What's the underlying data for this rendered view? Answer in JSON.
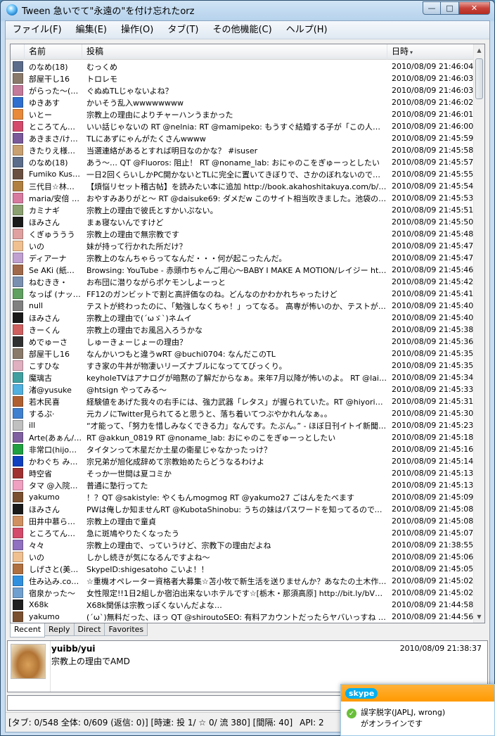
{
  "window": {
    "title": "Tween 急いでて\"永遠の\"を付け忘れたorz",
    "min_glyph": "—",
    "max_glyph": "□",
    "close_glyph": "✕"
  },
  "menu": [
    "ファイル(F)",
    "編集(E)",
    "操作(O)",
    "タブ(T)",
    "その他機能(C)",
    "ヘルプ(H)"
  ],
  "columns": {
    "name": "名前",
    "post": "投稿",
    "date": "日時",
    "sort_glyph": "▾"
  },
  "rows": [
    {
      "name": "のなめ(18)",
      "post": "むっくめ",
      "date": "2010/08/09 21:46:04",
      "color": "#5b6d8a"
    },
    {
      "name": "部屋干し16",
      "post": "トロレモ",
      "date": "2010/08/09 21:46:03",
      "color": "#8a7a6a"
    },
    {
      "name": "がらった～(が…",
      "post": "ぐぬぬTLじゃないよね？",
      "date": "2010/08/09 21:46:03",
      "color": "#c47a9a"
    },
    {
      "name": "ゆきあす",
      "post": "かいそう乱入wwwwwwww",
      "date": "2010/08/09 21:46:02",
      "color": "#2e6fd0"
    },
    {
      "name": "いとー",
      "post": "宗教上の理由によりチャーハンうまかった",
      "date": "2010/08/09 21:46:01",
      "color": "#e88a3a"
    },
    {
      "name": "ところてん@…",
      "post": "いい話じゃないの RT @nelnia: RT @mamipeko: もうすぐ結婚する子が「この人となら幸せ…",
      "date": "2010/08/09 21:46:00",
      "color": "#d44a6a"
    },
    {
      "name": "あきまさ/けい…",
      "post": "TLにあずにゃんがたくさんwwww",
      "date": "2010/08/09 21:45:59",
      "color": "#7a5a9a"
    },
    {
      "name": "きたりえ様@…",
      "post": "当選連絡があるとすれば明日なのかな？ #isuser",
      "date": "2010/08/09 21:45:58",
      "color": "#c9a070"
    },
    {
      "name": "のなめ(18)",
      "post": "あう～… QT @Fluoros: 阻止！ RT @noname_lab: おにゃのこをぎゅーっとしたい",
      "date": "2010/08/09 21:45:57",
      "color": "#5b6d8a"
    },
    {
      "name": "Fumiko Kus…",
      "post": "一日2回くらいしかPC開かないとTLに完全に置いてきぼりで、さかのぼれないのであきらめた…",
      "date": "2010/08/09 21:45:55",
      "color": "#6a5040"
    },
    {
      "name": "三代目☆林…",
      "post": "【煩悩リセット稽古帖】を読みたい本に追加 http://book.akahoshitakuya.com/b/48875…",
      "date": "2010/08/09 21:45:54",
      "color": "#b08040"
    },
    {
      "name": "maria/安倍 …",
      "post": "おやすみありがと～ RT @daisuke69: ダメだw このサイト相当吹きました。池袋の梅本の…",
      "date": "2010/08/09 21:45:53",
      "color": "#d87aa0"
    },
    {
      "name": "カミナギ",
      "post": "宗教上の理由で彼氏とすかいぷない。",
      "date": "2010/08/09 21:45:51",
      "color": "#8aa070"
    },
    {
      "name": "ほみさん",
      "post": "まぁ寝ないんですけど",
      "date": "2010/08/09 21:45:50",
      "color": "#1a1a1a"
    },
    {
      "name": "くぎゅううう",
      "post": "宗教上の理由で無宗教です",
      "date": "2010/08/09 21:45:48",
      "color": "#e0a0a0"
    },
    {
      "name": "いの",
      "post": "妹が持って行かれた所だけ？",
      "date": "2010/08/09 21:45:47",
      "color": "#f0c090"
    },
    {
      "name": "ディアーナ",
      "post": "宗教上のなんちゃらってなんだ・・・何が起こったんだ。",
      "date": "2010/08/09 21:45:47",
      "color": "#c0a0d0"
    },
    {
      "name": "Se AKi (紙…",
      "post": "Browsing: YouTube - 赤頭巾ちゃんご用心～BABY I MAKE A MOTION/レイジー htt…",
      "date": "2010/08/09 21:45:46",
      "color": "#a06a4a"
    },
    {
      "name": "ねむきき・",
      "post": "お布団に潜りながらポケモンしよーっと",
      "date": "2010/08/09 21:45:42",
      "color": "#7a90b0"
    },
    {
      "name": "なっぱ (ナッ…",
      "post": "FF12のガンビットで割と高評価なのね。どんなのかわかれちゃったけど",
      "date": "2010/08/09 21:45:41",
      "color": "#60a060"
    },
    {
      "name": "null",
      "post": "テストが終わったのに、「勉強しなくちゃ！」ってなる。 高専が怖いのか、テストが怖いのか…",
      "date": "2010/08/09 21:45:40",
      "color": "#808080"
    },
    {
      "name": "ほみさん",
      "post": "宗教上の理由で(´ωゞ`)ネムイ",
      "date": "2010/08/09 21:45:40",
      "color": "#1a1a1a"
    },
    {
      "name": "きーくん",
      "post": "宗教上の理由でお風呂入ろうかな",
      "date": "2010/08/09 21:45:38",
      "color": "#d06060"
    },
    {
      "name": "めでゅーさ",
      "post": "しゅーきょーじょーの理由？",
      "date": "2010/08/09 21:45:36",
      "color": "#303030"
    },
    {
      "name": "部屋干し16",
      "post": "なんかいつもと違うwRT @buchi0704: なんだこのTL",
      "date": "2010/08/09 21:45:35",
      "color": "#8a7a6a"
    },
    {
      "name": "こすひな",
      "post": "すき家の牛丼が物凄いリーズナブルになっててびっくり。",
      "date": "2010/08/09 21:45:35",
      "color": "#e0b0c0"
    },
    {
      "name": "魔璃古",
      "post": "keyholeTVはアナログが暗黙の了解だからなぁ。来年7月以降が怖いのよ。 RT @lain_the…",
      "date": "2010/08/09 21:45:34",
      "color": "#40a0a0"
    },
    {
      "name": "渚@yusuke",
      "post": "@htsign やってみる～",
      "date": "2010/08/09 21:45:33",
      "color": "#50b0e0"
    },
    {
      "name": "若木民喜",
      "post": "経験値をあげた我々の右手には、強力武器「レタス」が握られていた。RT @hiyori302: @a…",
      "date": "2010/08/09 21:45:31",
      "color": "#b06030"
    },
    {
      "name": "するぷ·",
      "post": "元カノにTwitter見られてると思うと、落ち着いてつぶやかれんなぁ。。",
      "date": "2010/08/09 21:45:30",
      "color": "#4080d0"
    },
    {
      "name": "ill",
      "post": "“才能って、「努力を惜しみなくできる力」なんです。たぶん。” - ほぼ日刊イトイ新聞 - 京…",
      "date": "2010/08/09 21:45:23",
      "color": "#c0c0c0"
    },
    {
      "name": "Arte(あぁん/…",
      "post": "RT @akkun_0819 RT @noname_lab: おにゃのこをぎゅーっとしたい",
      "date": "2010/08/09 21:45:18",
      "color": "#8060a0"
    },
    {
      "name": "非常口(hijo…",
      "post": "タイタンって木星だか土星の衛星じゃなかったっけ？",
      "date": "2010/08/09 21:45:16",
      "color": "#20a040"
    },
    {
      "name": "かわぐち みさと",
      "post": "宗兄弟が旭化成辞めて宗教始めたらどうなるわけよ",
      "date": "2010/08/09 21:45:14",
      "color": "#1040c0"
    },
    {
      "name": "時空省",
      "post": "そっか一世間は夏コミか",
      "date": "2010/08/09 21:45:13",
      "color": "#a03030"
    },
    {
      "name": "タマ @入院…",
      "post": "普通に塾行ってた",
      "date": "2010/08/09 21:45:13",
      "color": "#f0a0c0"
    },
    {
      "name": "yakumo",
      "post": "！？QT @sakistyle: やくもんmogmog RT @yakumo27 ごはんをたべます",
      "date": "2010/08/09 21:45:09",
      "color": "#7a5030"
    },
    {
      "name": "ほみさん",
      "post": "PWは俺しか知ませんRT @KubotaShinobu: うちの妹はパスワードを知ってるので、ふつー…",
      "date": "2010/08/09 21:45:08",
      "color": "#1a1a1a"
    },
    {
      "name": "田井中慕ら…",
      "post": "宗教上の理由で童貞",
      "date": "2010/08/09 21:45:08",
      "color": "#d09060"
    },
    {
      "name": "ところてん@…",
      "post": "急に斑鳩やりたくなったう",
      "date": "2010/08/09 21:45:07",
      "color": "#d44a6a"
    },
    {
      "name": "々々",
      "post": "宗教上の理由で、っていうけど、宗教下の理由だよね",
      "date": "2010/08/09 21:38:55",
      "color": "#9070c0"
    },
    {
      "name": "いの",
      "post": "しかし続きが気になるんですよね～",
      "date": "2010/08/09 21:45:06",
      "color": "#f0c090"
    },
    {
      "name": "しげさと(美…",
      "post": "SkypeID:shigesatoho こいよ！！",
      "date": "2010/08/09 21:45:05",
      "color": "#b07040"
    },
    {
      "name": "住み込み.co…",
      "post": "☆重機オペレーター資格者大募集☆苫小牧で新生活を送りませんか？あなたの土木作…",
      "date": "2010/08/09 21:45:02",
      "color": "#3090e0"
    },
    {
      "name": "宿泉かった～",
      "post": "女性限定!!1日2組しか宿泊出来ないホテルです☆[栃木・那須高原] http://bit.ly/bV7…",
      "date": "2010/08/09 21:45:02",
      "color": "#70a0d0"
    },
    {
      "name": "X68k",
      "post": "X68k関係は宗教っぽくないんだよな…",
      "date": "2010/08/09 21:44:58",
      "color": "#202020"
    },
    {
      "name": "yakumo",
      "post": "(´ω`)無料だった、ほっ QT @shiroutoSEO: 有料アカウントだったらヤバいっすね RT QT…",
      "date": "2010/08/09 21:44:56",
      "color": "#7a5030"
    }
  ],
  "tabs": [
    "Recent",
    "Reply",
    "Direct",
    "Favorites"
  ],
  "detail": {
    "name": "yuibb/yui",
    "date": "2010/08/09 21:38:37",
    "text": "宗教上の理由でAMD"
  },
  "status": {
    "main": "[タブ: 0/548 全体: 0/609 (返信: 0)] [時速: 投 1/ ☆ 0/ 流 380] [間隔: 40]",
    "api": "API: 2"
  },
  "skype_popup": {
    "logo": "skype",
    "check": "✓",
    "line1": "誤字脱字(JAPLJ, wrong)",
    "line2": "がオンラインです"
  }
}
